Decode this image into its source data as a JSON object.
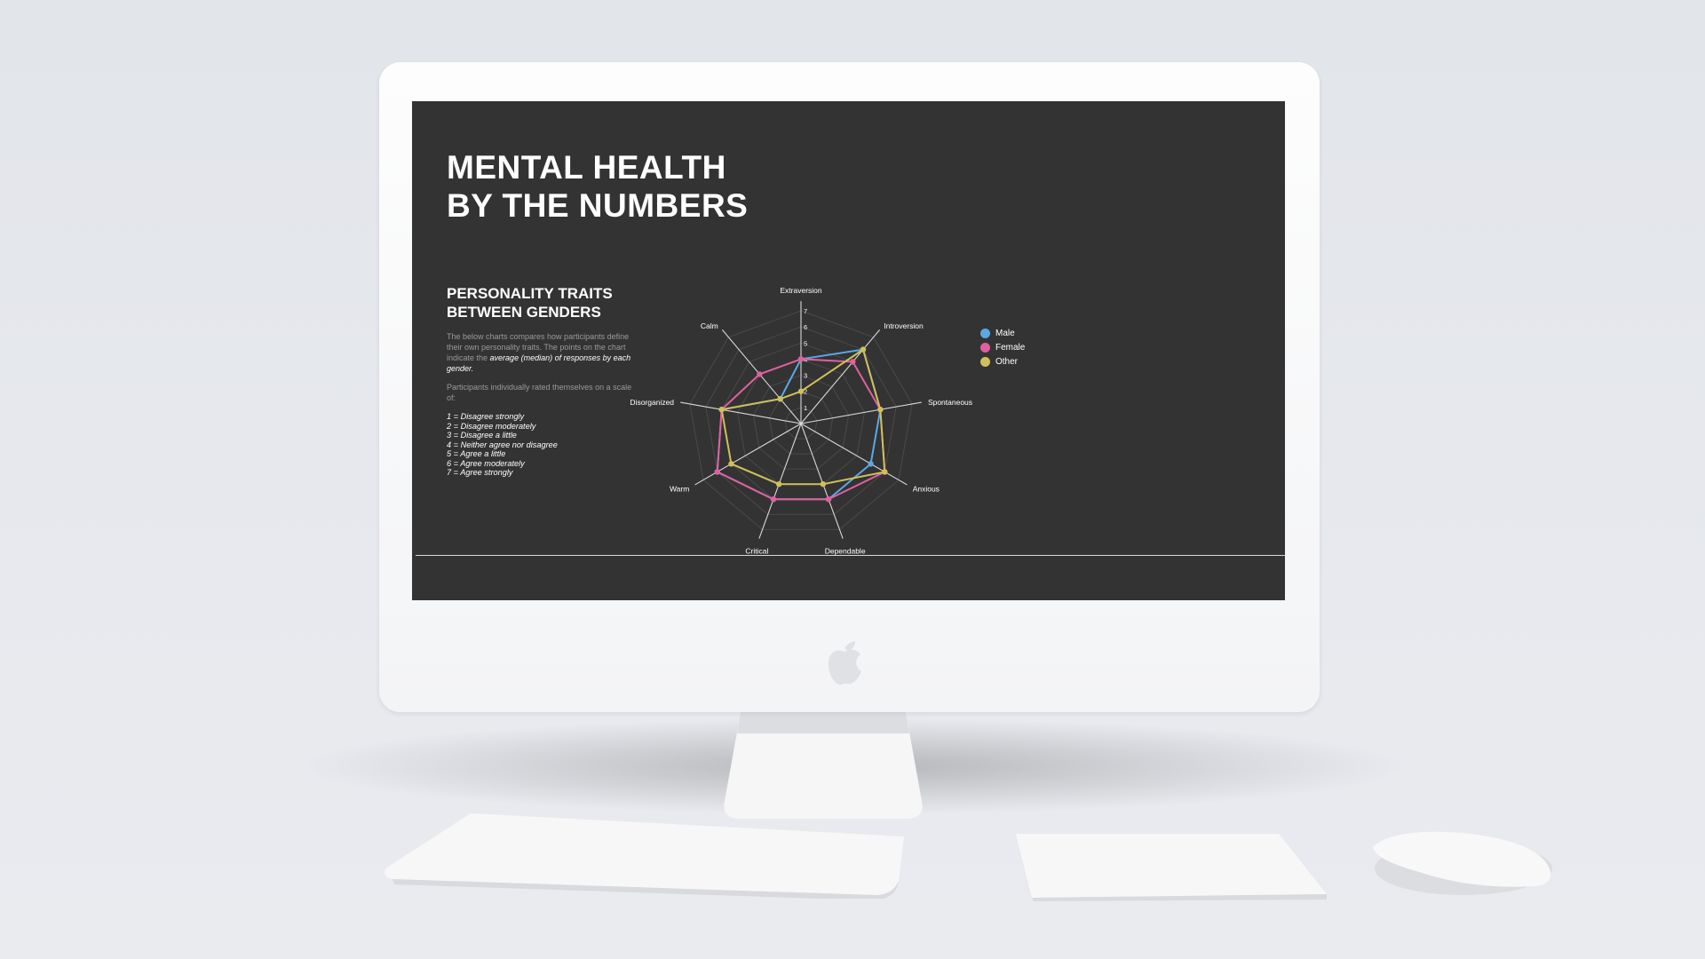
{
  "presentation": {
    "title_line1": "MENTAL HEALTH",
    "title_line2": "BY THE NUMBERS",
    "section_title_line1": "PERSONALITY TRAITS",
    "section_title_line2": "BETWEEN GENDERS",
    "description_part1": "The below charts compares how participants define their own personality traits. The points on the chart indicate the ",
    "description_emphasis": "average (median) of responses by each gender.",
    "scale_intro": "Participants individually rated themselves on a scale of:",
    "scale_items": [
      "1 = Disagree strongly",
      "2 = Disagree moderately",
      "3 = Disagree a little",
      "4 = Neither agree nor disagree",
      "5 = Agree a little",
      "6 = Agree moderately",
      "7 = Agree strongly"
    ]
  },
  "colors": {
    "background": "#333333",
    "male": "#5aa9e6",
    "female": "#e0609f",
    "other": "#cfc05a",
    "grid": "#4a4a4a",
    "axis": "#d9d9d9"
  },
  "chart_data": {
    "type": "radar",
    "title": "",
    "axes": [
      "Extraversion",
      "Introversion",
      "Spontaneous",
      "Anxious",
      "Dependable",
      "Critical",
      "Warm",
      "Disorganized",
      "Calm"
    ],
    "rlim": [
      0,
      7
    ],
    "r_ticks": [
      "1",
      "2",
      "3",
      "4",
      "5",
      "6",
      "7"
    ],
    "legend_position": "right",
    "series": [
      {
        "name": "Male",
        "color": "#5aa9e6",
        "values": [
          4,
          6,
          5,
          5,
          5,
          5,
          6,
          5,
          2
        ]
      },
      {
        "name": "Female",
        "color": "#e0609f",
        "values": [
          4,
          5,
          5,
          6,
          5,
          5,
          6,
          5,
          4
        ]
      },
      {
        "name": "Other",
        "color": "#cfc05a",
        "values": [
          2,
          6,
          5,
          6,
          4,
          4,
          5,
          5,
          2
        ]
      }
    ]
  }
}
